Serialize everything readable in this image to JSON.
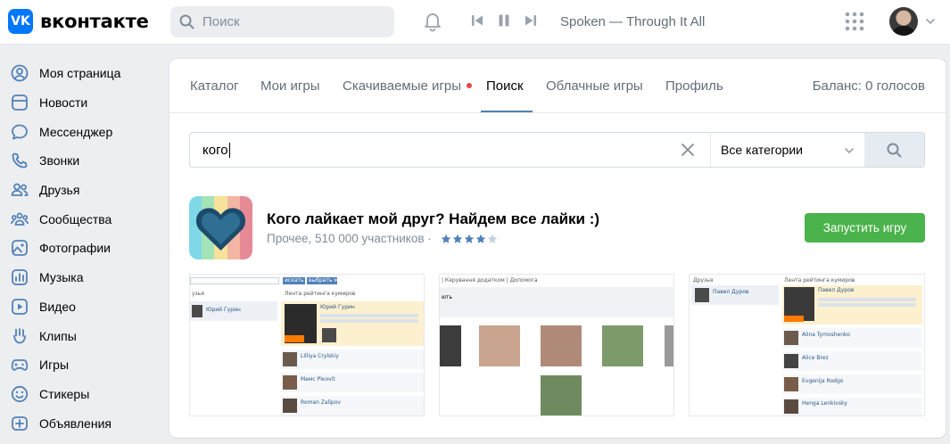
{
  "header": {
    "logo_mark": "VK",
    "logo_text": "вконтакте",
    "search_placeholder": "Поиск",
    "now_playing": "Spoken — Through It All"
  },
  "sidebar": {
    "items": [
      {
        "label": "Моя страница",
        "icon": "user-circle-icon"
      },
      {
        "label": "Новости",
        "icon": "news-icon"
      },
      {
        "label": "Мессенджер",
        "icon": "message-icon"
      },
      {
        "label": "Звонки",
        "icon": "phone-icon"
      },
      {
        "label": "Друзья",
        "icon": "friends-icon"
      },
      {
        "label": "Сообщества",
        "icon": "communities-icon"
      },
      {
        "label": "Фотографии",
        "icon": "photos-icon"
      },
      {
        "label": "Музыка",
        "icon": "music-icon"
      },
      {
        "label": "Видео",
        "icon": "video-icon"
      },
      {
        "label": "Клипы",
        "icon": "clips-icon"
      },
      {
        "label": "Игры",
        "icon": "gamepad-icon"
      },
      {
        "label": "Стикеры",
        "icon": "smile-icon"
      },
      {
        "label": "Объявления",
        "icon": "ads-icon"
      }
    ]
  },
  "tabs": {
    "items": [
      "Каталог",
      "Мои игры",
      "Скачиваемые игры",
      "Поиск",
      "Облачные игры",
      "Профиль"
    ],
    "active": "Поиск",
    "balance": "Баланс: 0 голосов"
  },
  "search": {
    "query": "кого",
    "category": "Все категории"
  },
  "app": {
    "title": "Кого лайкает мой друг? Найдем все лайки :)",
    "category": "Прочее,",
    "participants": "510 000 участников",
    "separator": "·",
    "rating": 4,
    "rating_max": 5,
    "launch_label": "Запустить игру"
  },
  "screenshots": {
    "shot1": {
      "btn1": "искать",
      "btn2": "выбрать мною",
      "col_left": "узья",
      "col_head": "Лента рейтинга кумиров",
      "user": "Юрий Гурин",
      "rows": [
        "Lilliya Crylskiy",
        "Мамс Рiкоvit",
        "Roman Zalipov"
      ]
    },
    "shot2": {
      "nav": "| Керування додатком | Допомога",
      "label": "ють"
    },
    "shot3": {
      "col_left": "Друзья",
      "col_head": "Лента рейтинга кумиров",
      "friend": "Павел Дуров",
      "user": "Павел Дуров",
      "rows": [
        "Alina Tymoshenko",
        "Alice Brez",
        "Evgenija Rodgo",
        "Henga Lenkivsky"
      ]
    }
  },
  "colors": {
    "accent": "#0077ff",
    "active_tab_underline": "#5181b8",
    "launch_button": "#4bb34b",
    "notification_dot": "#e64646"
  }
}
